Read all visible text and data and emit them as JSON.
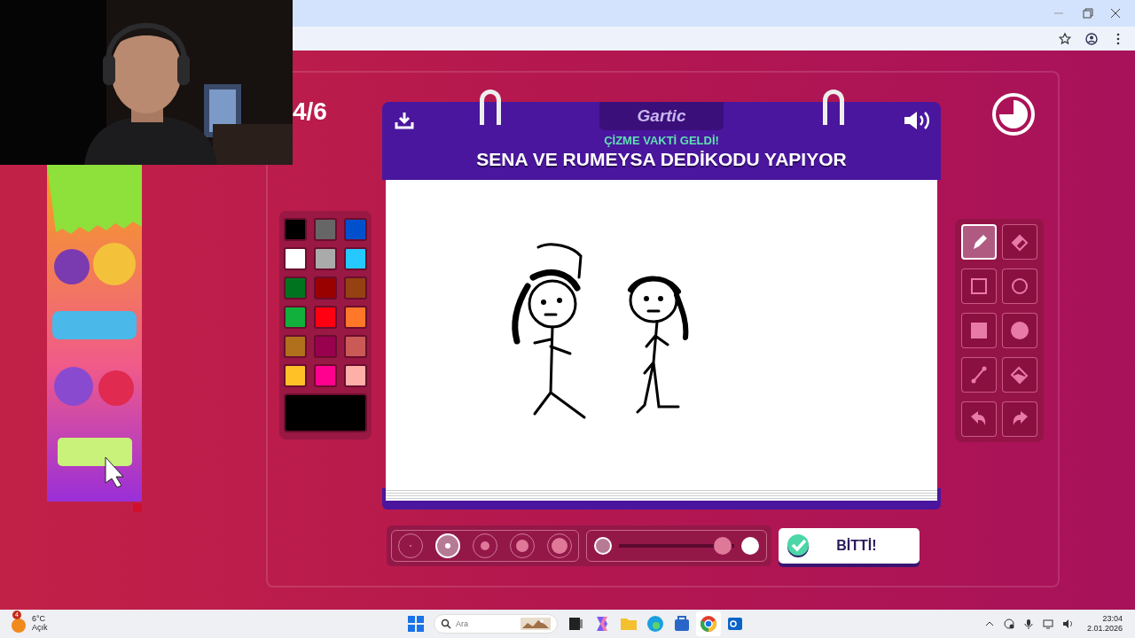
{
  "browser": {
    "window_controls": [
      {
        "kind": "minimize"
      },
      {
        "kind": "restore"
      },
      {
        "kind": "close"
      }
    ]
  },
  "round": {
    "counter": "4/6"
  },
  "board": {
    "logo": "Gartic",
    "subtitle": "ÇİZME VAKTİ GELDİ!",
    "prompt": "SENA VE RUMEYSA DEDİKODU YAPIYOR"
  },
  "palette": {
    "colors": [
      {
        "color": "#000000"
      },
      {
        "color": "#666666"
      },
      {
        "color": "#0050cd"
      },
      {
        "color": "#ffffff"
      },
      {
        "color": "#aaaaaa"
      },
      {
        "color": "#26c9ff"
      },
      {
        "color": "#017420"
      },
      {
        "color": "#990000"
      },
      {
        "color": "#964112"
      },
      {
        "color": "#11b03c"
      },
      {
        "color": "#ff0013"
      },
      {
        "color": "#ff7829"
      },
      {
        "color": "#b0701c"
      },
      {
        "color": "#99004e"
      },
      {
        "color": "#cb5a57"
      },
      {
        "color": "#ffc126"
      },
      {
        "color": "#ff008f"
      },
      {
        "color": "#feafa8"
      }
    ],
    "current": {
      "color": "#000000"
    }
  },
  "tools": [
    {
      "kind": "pencil",
      "selected": true
    },
    {
      "kind": "eraser",
      "selected": false
    },
    {
      "kind": "rectangle",
      "selected": false
    },
    {
      "kind": "ellipse",
      "selected": false
    },
    {
      "kind": "filled-rectangle",
      "selected": false
    },
    {
      "kind": "filled-ellipse",
      "selected": false
    },
    {
      "kind": "line",
      "selected": false
    },
    {
      "kind": "fill",
      "selected": false
    },
    {
      "kind": "undo",
      "selected": false
    },
    {
      "kind": "redo",
      "selected": false
    }
  ],
  "brush_sizes": [
    {
      "selected": false
    },
    {
      "selected": true
    },
    {
      "selected": false
    },
    {
      "selected": false
    },
    {
      "selected": false
    }
  ],
  "opacity": {
    "level": 0.97
  },
  "done_button": {
    "label": "BİTTİ!"
  },
  "taskbar": {
    "weather": {
      "badge": "4",
      "temperature": "6°C",
      "condition": "Açık"
    },
    "search": {
      "placeholder": "Ara"
    },
    "apps": [
      {
        "kind": "start",
        "selected": false
      },
      {
        "kind": "taskview",
        "selected": false
      },
      {
        "kind": "copilot",
        "selected": false
      },
      {
        "kind": "explorer",
        "selected": false
      },
      {
        "kind": "edge",
        "selected": false
      },
      {
        "kind": "store",
        "selected": false
      },
      {
        "kind": "chrome",
        "selected": true
      },
      {
        "kind": "outlook",
        "selected": false
      }
    ],
    "time": "23:04",
    "date": "2.01.2026"
  }
}
